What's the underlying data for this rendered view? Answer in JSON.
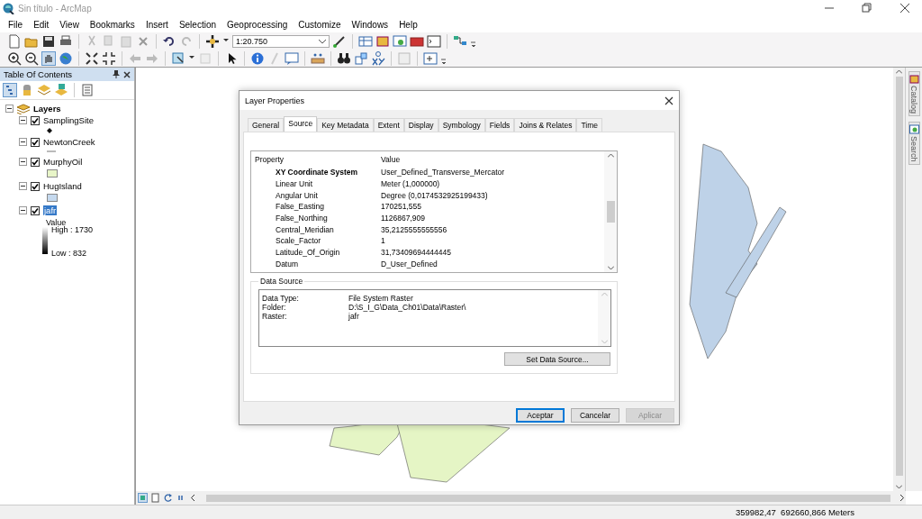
{
  "window": {
    "title": "Sin título - ArcMap"
  },
  "menu": [
    "File",
    "Edit",
    "View",
    "Bookmarks",
    "Insert",
    "Selection",
    "Geoprocessing",
    "Customize",
    "Windows",
    "Help"
  ],
  "toolbar": {
    "scale": "1:20.750"
  },
  "toc": {
    "title": "Table Of Contents",
    "root": {
      "label": "Layers",
      "expanded": true,
      "children": [
        {
          "label": "SamplingSite",
          "checked": true,
          "selected": false,
          "expanded": true,
          "legend": {
            "kind": "point"
          }
        },
        {
          "label": "NewtonCreek",
          "checked": true,
          "selected": false,
          "expanded": true,
          "legend": {
            "kind": "line"
          }
        },
        {
          "label": "MurphyOil",
          "checked": true,
          "selected": false,
          "expanded": true,
          "legend": {
            "kind": "fill",
            "color": "#e8f5c8"
          }
        },
        {
          "label": "HugIsland",
          "checked": true,
          "selected": false,
          "expanded": true,
          "legend": {
            "kind": "fill",
            "color": "#c5d9ee"
          }
        },
        {
          "label": "jafr",
          "checked": true,
          "selected": true,
          "expanded": true,
          "legend": {
            "kind": "raster",
            "heading": "Value",
            "high": "High : 1730",
            "low": "Low : 832"
          }
        }
      ]
    }
  },
  "dock_tabs": [
    "Catalog",
    "Search"
  ],
  "dialog": {
    "title": "Layer Properties",
    "tabs": [
      {
        "label": "General",
        "selected": false
      },
      {
        "label": "Source",
        "selected": true
      },
      {
        "label": "Key Metadata",
        "selected": false
      },
      {
        "label": "Extent",
        "selected": false
      },
      {
        "label": "Display",
        "selected": false
      },
      {
        "label": "Symbology",
        "selected": false
      },
      {
        "label": "Fields",
        "selected": false
      },
      {
        "label": "Joins & Relates",
        "selected": false
      },
      {
        "label": "Time",
        "selected": false
      }
    ],
    "property_table": {
      "columns": [
        "Property",
        "Value"
      ],
      "rows": [
        {
          "kind": "heading",
          "property": "XY Coordinate System",
          "value": "User_Defined_Transverse_Mercator"
        },
        {
          "kind": "item",
          "property": "Linear Unit",
          "value": "Meter (1,000000)"
        },
        {
          "kind": "item",
          "property": "Angular Unit",
          "value": "Degree (0,0174532925199433)"
        },
        {
          "kind": "item",
          "property": "False_Easting",
          "value": "170251,555"
        },
        {
          "kind": "item",
          "property": "False_Northing",
          "value": "1126867,909"
        },
        {
          "kind": "item",
          "property": "Central_Meridian",
          "value": "35,2125555555556"
        },
        {
          "kind": "item",
          "property": "Scale_Factor",
          "value": "1"
        },
        {
          "kind": "item",
          "property": "Latitude_Of_Origin",
          "value": "31,73409694444445"
        },
        {
          "kind": "item",
          "property": "Datum",
          "value": "D_User_Defined"
        }
      ]
    },
    "data_source": {
      "title": "Data Source",
      "rows": [
        {
          "label": "Data Type:",
          "value": "File System Raster"
        },
        {
          "label": "Folder:",
          "value": "D:\\S_I_G\\Data_Ch01\\Data\\Raster\\"
        },
        {
          "label": "Raster:",
          "value": "jafr"
        }
      ],
      "button": "Set Data Source..."
    },
    "buttons": [
      {
        "label": "Aceptar",
        "default": true,
        "disabled": false
      },
      {
        "label": "Cancelar",
        "default": false,
        "disabled": false
      },
      {
        "label": "Aplicar",
        "default": false,
        "disabled": true
      }
    ]
  },
  "status_bar": {
    "coordinates": "359982,47  692660,866 Meters"
  }
}
